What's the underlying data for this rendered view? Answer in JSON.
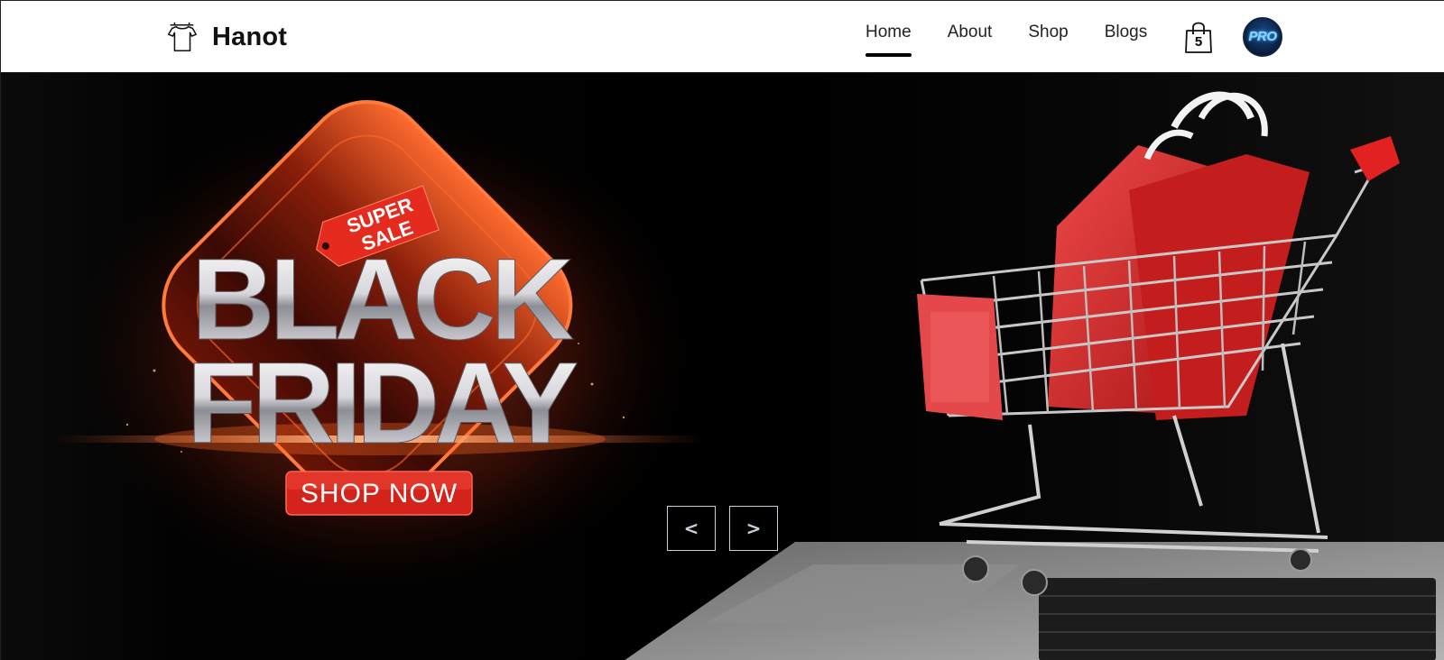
{
  "brand": {
    "name": "Hanot",
    "icon": "tshirt-icon"
  },
  "nav": {
    "items": [
      {
        "label": "Home",
        "active": true
      },
      {
        "label": "About",
        "active": false
      },
      {
        "label": "Shop",
        "active": false
      },
      {
        "label": "Blogs",
        "active": false
      }
    ]
  },
  "cart": {
    "icon": "shopping-bag-icon",
    "count": "5"
  },
  "avatar": {
    "text": "PRO"
  },
  "hero": {
    "badge": "SUPER SALE",
    "badge_line1": "SUPER",
    "badge_line2": "SALE",
    "title_line1": "BLACK",
    "title_line2": "FRIDAY",
    "cta": "SHOP NOW",
    "accent_color": "#e8321e"
  },
  "slider": {
    "prev_label": "<",
    "next_label": ">"
  }
}
